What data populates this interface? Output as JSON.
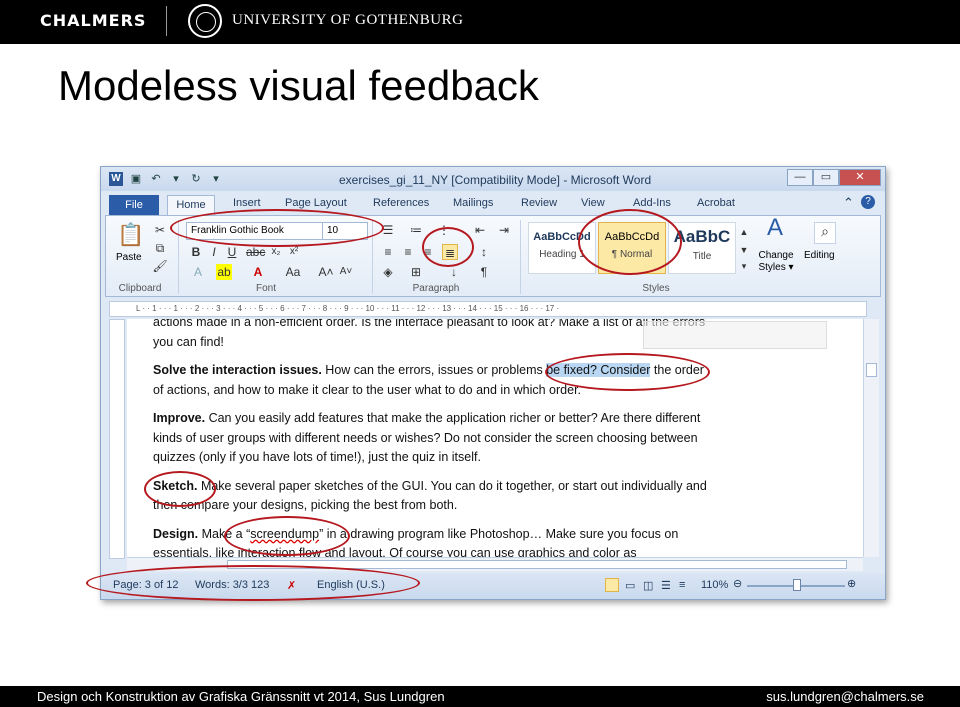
{
  "header": {
    "chalmers": "CHALMERS",
    "university": "UNIVERSITY OF GOTHENBURG"
  },
  "slide_title": "Modeless visual feedback",
  "word": {
    "window_title": "exercises_gi_11_NY [Compatibility Mode] - Microsoft Word",
    "tabs": [
      "File",
      "Home",
      "Insert",
      "Page Layout",
      "References",
      "Mailings",
      "Review",
      "View",
      "Add-Ins",
      "Acrobat"
    ],
    "font_name": "Franklin Gothic Book",
    "font_size": "10",
    "groups": {
      "clipboard": "Clipboard",
      "font": "Font",
      "paragraph": "Paragraph",
      "styles": "Styles"
    },
    "paste_label": "Paste",
    "styles": [
      {
        "sample": "AaBbCcDd",
        "name": "Heading 1"
      },
      {
        "sample": "AaBbCcDd",
        "name": "¶ Normal"
      },
      {
        "sample": "AaBbC",
        "name": "Title"
      }
    ],
    "change_styles": "Change Styles ▾",
    "editing": "Editing",
    "ruler": "L · · 1 · · · 1 · · · 2 · · · 3 · · · 4 · · · 5 · · · 6 · · · 7 · · · 8 · · · 9 · · · 10 · · · 11 · · · 12 · · · 13 · · · 14 · · · 15 · · · 16 · · · 17 ·",
    "doc": {
      "p0": "actions made in a non-efficient order. Is the interface pleasant to look at? Make a list of all the errors you can find!",
      "p1_bold": "Solve the interaction issues.",
      "p1_a": " How can the errors, issues or problems ",
      "p1_sel": "be fixed? Consider",
      "p1_b": " the order of actions, and how to make it clear to the user what to do and in which order.",
      "p2_bold": "Improve.",
      "p2": " Can you easily add features that make the application richer or better? Are there different kinds of user groups with different needs or wishes? Do not consider the screen choosing between quizzes (only if you have lots of time!), just the quiz in itself.",
      "p3_bold": "Sketch.",
      "p3": " Make several paper sketches of the GUI. You can do it together, or start out individually and then compare your designs, picking the best from both.",
      "p4_bold": "Design.",
      "p4_a": " Make a “",
      "p4_sq": "screendump",
      "p4_b": "” in a drawing program like Photoshop… Make sure you focus on essentials, like interaction flow and layout. Of course you can use graphics and color as"
    },
    "status": {
      "page": "Page: 3 of 12",
      "words": "Words: 3/3 123",
      "language": "English (U.S.)",
      "zoom": "110%"
    }
  },
  "footer": {
    "left": "Design och Konstruktion av Grafiska Gränssnitt vt 2014, Sus Lundgren",
    "right": "sus.lundgren@chalmers.se"
  }
}
